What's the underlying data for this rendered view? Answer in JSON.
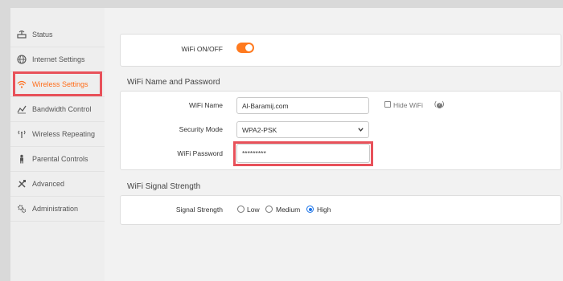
{
  "sidebar": {
    "items": [
      {
        "label": "Status",
        "icon": "status-icon"
      },
      {
        "label": "Internet Settings",
        "icon": "globe-icon"
      },
      {
        "label": "Wireless Settings",
        "icon": "wifi-icon",
        "active": true
      },
      {
        "label": "Bandwidth Control",
        "icon": "bandwidth-icon"
      },
      {
        "label": "Wireless Repeating",
        "icon": "repeater-icon"
      },
      {
        "label": "Parental Controls",
        "icon": "parental-icon"
      },
      {
        "label": "Advanced",
        "icon": "tools-icon"
      },
      {
        "label": "Administration",
        "icon": "gears-icon"
      }
    ]
  },
  "wifi_toggle": {
    "label": "WiFi ON/OFF",
    "on": true
  },
  "name_password": {
    "title": "WiFi Name and Password",
    "wifi_name_label": "WiFi Name",
    "wifi_name_value": "Al-Baramij.com",
    "hide_wifi_label": "Hide WiFi",
    "hide_wifi_checked": false,
    "help_icon": "help-icon",
    "security_mode_label": "Security Mode",
    "security_mode_value": "WPA2-PSK",
    "password_label": "WiFi Password",
    "password_value": "*********"
  },
  "signal": {
    "title": "WiFi Signal Strength",
    "label": "Signal Strength",
    "options": [
      "Low",
      "Medium",
      "High"
    ],
    "selected": "High"
  },
  "colors": {
    "accent": "#ff6d1a",
    "highlight": "#e8515a",
    "radio_selected": "#1a73e8"
  }
}
